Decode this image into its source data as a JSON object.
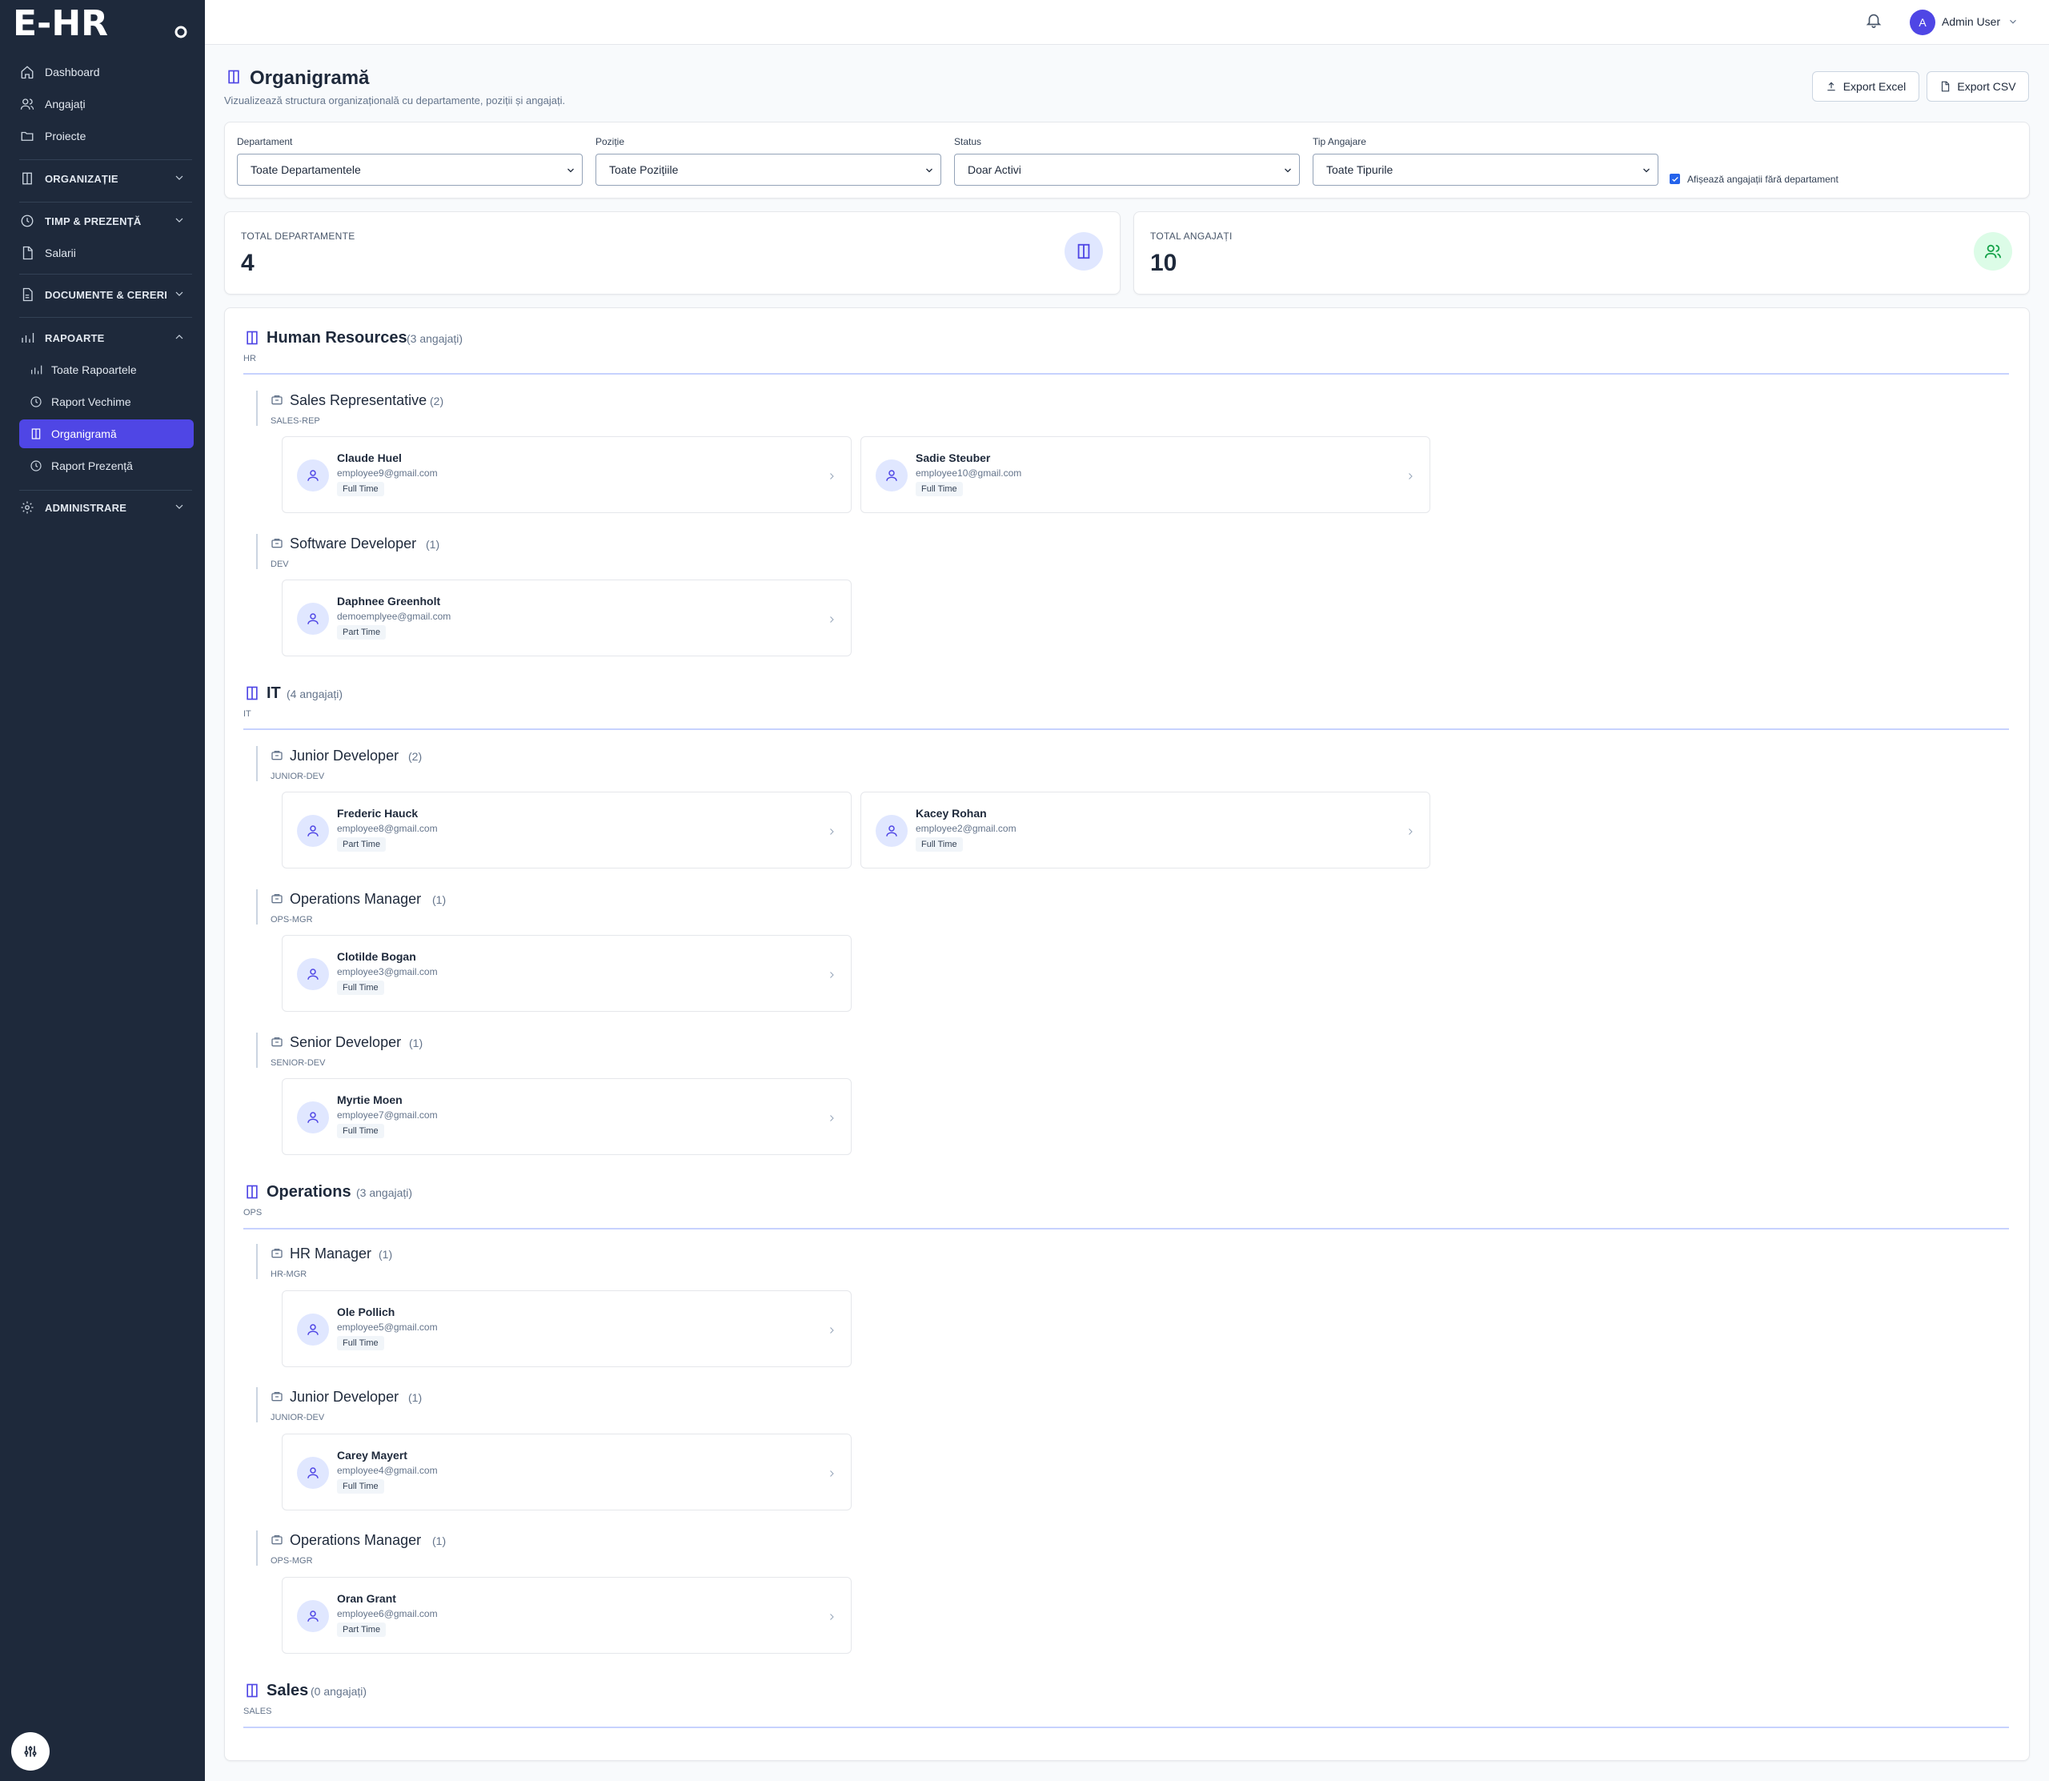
{
  "brand": {
    "logo_text": "E-HR"
  },
  "sidebar": {
    "top_items": [
      {
        "label": "Dashboard",
        "icon": "home-icon"
      },
      {
        "label": "Angajați",
        "icon": "users-icon"
      },
      {
        "label": "Proiecte",
        "icon": "folder-icon"
      }
    ],
    "sections": {
      "organizatie": "ORGANIZAȚIE",
      "timp": "TIMP & PREZENȚĂ",
      "salarii": "Salarii",
      "documente": "DOCUMENTE & CERERI",
      "rapoarte": "RAPOARTE",
      "administrare": "ADMINISTRARE"
    },
    "rapoarte_items": [
      {
        "label": "Toate Rapoartele",
        "icon": "chart-icon"
      },
      {
        "label": "Raport Vechime",
        "icon": "clock-icon"
      },
      {
        "label": "Organigramă",
        "icon": "building-icon",
        "active": true
      },
      {
        "label": "Raport Prezență",
        "icon": "clock-icon"
      }
    ]
  },
  "header": {
    "user_initial": "A",
    "user_name": "Admin User"
  },
  "page": {
    "title": "Organigramă",
    "subtitle": "Vizualizează structura organizațională cu departamente, poziții și angajați.",
    "export_excel": "Export Excel",
    "export_csv": "Export CSV"
  },
  "filters": {
    "departament": {
      "label": "Departament",
      "value": "Toate Departamentele"
    },
    "pozitie": {
      "label": "Poziție",
      "value": "Toate Pozițiile"
    },
    "status": {
      "label": "Status",
      "value": "Doar Activi"
    },
    "tip": {
      "label": "Tip Angajare",
      "value": "Toate Tipurile"
    },
    "show_no_dept": "Afișează angajații fără departament"
  },
  "stats": {
    "total_departments_label": "TOTAL DEPARTAMENTE",
    "total_departments": "4",
    "total_employees_label": "TOTAL ANGAJAȚI",
    "total_employees": "10"
  },
  "colors": {
    "accent": "#4f46e5",
    "sidebar": "#1e293b",
    "green_bg": "#dcfce7",
    "indigo_bg": "#e0e7ff"
  },
  "departments": [
    {
      "name": "Human Resources",
      "count": "(3 angajați)",
      "code": "HR",
      "positions": [
        {
          "name": "Sales Representative",
          "count": "(2)",
          "code": "SALES-REP",
          "employees": [
            {
              "name": "Claude Huel",
              "email": "employee9@gmail.com",
              "type": "Full Time"
            },
            {
              "name": "Sadie Steuber",
              "email": "employee10@gmail.com",
              "type": "Full Time"
            }
          ]
        },
        {
          "name": "Software Developer",
          "count": "(1)",
          "code": "DEV",
          "employees": [
            {
              "name": "Daphnee Greenholt",
              "email": "demoemplyee@gmail.com",
              "type": "Part Time"
            }
          ]
        }
      ]
    },
    {
      "name": "IT",
      "count": "(4 angajați)",
      "code": "IT",
      "positions": [
        {
          "name": "Junior Developer",
          "count": "(2)",
          "code": "JUNIOR-DEV",
          "employees": [
            {
              "name": "Frederic Hauck",
              "email": "employee8@gmail.com",
              "type": "Part Time"
            },
            {
              "name": "Kacey Rohan",
              "email": "employee2@gmail.com",
              "type": "Full Time"
            }
          ]
        },
        {
          "name": "Operations Manager",
          "count": "(1)",
          "code": "OPS-MGR",
          "employees": [
            {
              "name": "Clotilde Bogan",
              "email": "employee3@gmail.com",
              "type": "Full Time"
            }
          ]
        },
        {
          "name": "Senior Developer",
          "count": "(1)",
          "code": "SENIOR-DEV",
          "employees": [
            {
              "name": "Myrtie Moen",
              "email": "employee7@gmail.com",
              "type": "Full Time"
            }
          ]
        }
      ]
    },
    {
      "name": "Operations",
      "count": "(3 angajați)",
      "code": "OPS",
      "positions": [
        {
          "name": "HR Manager",
          "count": "(1)",
          "code": "HR-MGR",
          "employees": [
            {
              "name": "Ole Pollich",
              "email": "employee5@gmail.com",
              "type": "Full Time"
            }
          ]
        },
        {
          "name": "Junior Developer",
          "count": "(1)",
          "code": "JUNIOR-DEV",
          "employees": [
            {
              "name": "Carey Mayert",
              "email": "employee4@gmail.com",
              "type": "Full Time"
            }
          ]
        },
        {
          "name": "Operations Manager",
          "count": "(1)",
          "code": "OPS-MGR",
          "employees": [
            {
              "name": "Oran Grant",
              "email": "employee6@gmail.com",
              "type": "Part Time"
            }
          ]
        }
      ]
    },
    {
      "name": "Sales",
      "count": "(0 angajați)",
      "code": "SALES",
      "positions": []
    }
  ]
}
